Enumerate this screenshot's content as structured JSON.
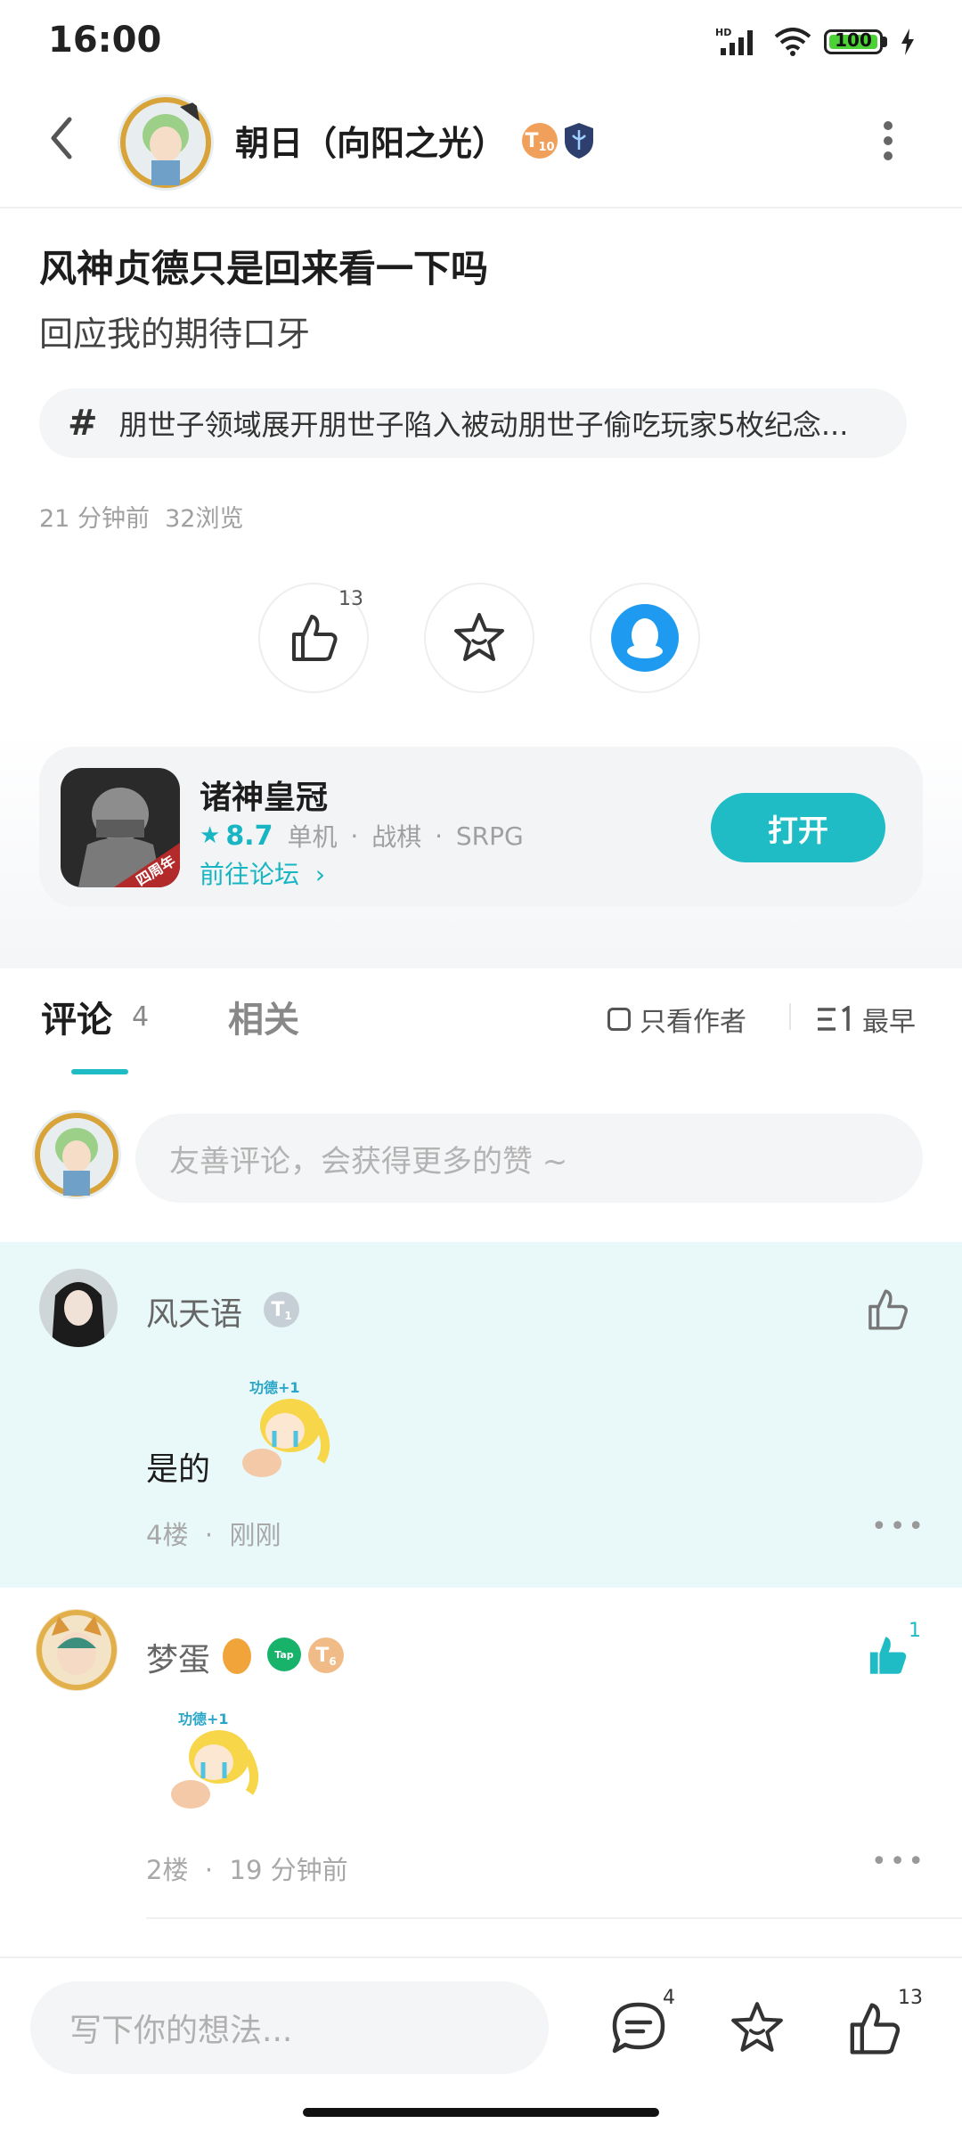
{
  "status_bar": {
    "time": "16:00",
    "battery": "100",
    "network": "HD"
  },
  "header": {
    "author_name": "朝日（向阳之光）",
    "badge_level": "T",
    "badge_sub": "10"
  },
  "post": {
    "title": "风神贞德只是回来看一下吗",
    "subtitle": "回应我的期待口牙",
    "topic": "朋世子领域展开朋世子陷入被动朋世子偷吃玩家5枚纪念...",
    "time": "21 分钟前",
    "views": "32浏览",
    "like_count": "13"
  },
  "game": {
    "name": "诸神皇冠",
    "rating": "8.7",
    "tags": [
      "单机",
      "战棋",
      "SRPG"
    ],
    "forum_link": "前往论坛",
    "open_label": "打开",
    "icon_banner": "四周年"
  },
  "tabs": {
    "comments_label": "评论",
    "comments_count": "4",
    "related_label": "相关",
    "author_only": "只看作者",
    "sort_label": "最早"
  },
  "comment_input_placeholder": "友善评论，会获得更多的赞 ~",
  "comments": [
    {
      "name": "风天语",
      "badge": "T",
      "badge_sub": "1",
      "text": "是的",
      "sticker_caption": "功德+1",
      "floor": "4楼",
      "time": "刚刚",
      "likes": ""
    },
    {
      "name": "梦蛋",
      "badge": "T",
      "badge_sub": "6",
      "tap_badge": "Tap",
      "text": "",
      "sticker_caption": "功德+1",
      "floor": "2楼",
      "time": "19 分钟前",
      "likes": "1"
    }
  ],
  "bottom_bar": {
    "placeholder": "写下你的想法...",
    "comment_count": "4",
    "like_count": "13"
  },
  "colors": {
    "accent": "#1fbcc6",
    "highlight_bg": "#e9f8f8",
    "qq_blue": "#1e9bf0"
  },
  "icons": [
    "back-icon",
    "more-icon",
    "thumbs-up-icon",
    "star-icon",
    "qq-icon",
    "chevron-right-icon",
    "sort-icon",
    "comment-icon"
  ]
}
